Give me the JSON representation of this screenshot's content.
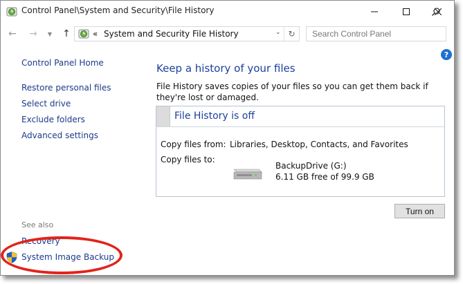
{
  "window": {
    "title": "Control Panel\\System and Security\\File History"
  },
  "navbar": {
    "breadcrumb_overflow": "«",
    "breadcrumb": [
      "System and Security",
      "File History"
    ],
    "search_placeholder": "Search Control Panel"
  },
  "sidebar": {
    "items": [
      {
        "label": "Control Panel Home"
      },
      {
        "label": "Restore personal files"
      },
      {
        "label": "Select drive"
      },
      {
        "label": "Exclude folders"
      },
      {
        "label": "Advanced settings"
      }
    ],
    "see_also_heading": "See also",
    "see_also": [
      {
        "label": "Recovery"
      },
      {
        "label": "System Image Backup",
        "icon": "uac-shield-icon"
      }
    ]
  },
  "main": {
    "heading": "Keep a history of your files",
    "description": "File History saves copies of your files so you can get them back if they're lost or damaged.",
    "status": {
      "title": "File History is off",
      "copy_from_label": "Copy files from:",
      "copy_from_value": "Libraries, Desktop, Contacts, and Favorites",
      "copy_to_label": "Copy files to:",
      "drive_name": "BackupDrive (G:)",
      "drive_free": "6.11 GB free of 99.9 GB"
    },
    "turn_on_label": "Turn on"
  },
  "colors": {
    "link": "#1a3a8a",
    "heading": "#1b3f9c",
    "highlight_oval": "#e2231a",
    "help": "#1f6fd1"
  }
}
